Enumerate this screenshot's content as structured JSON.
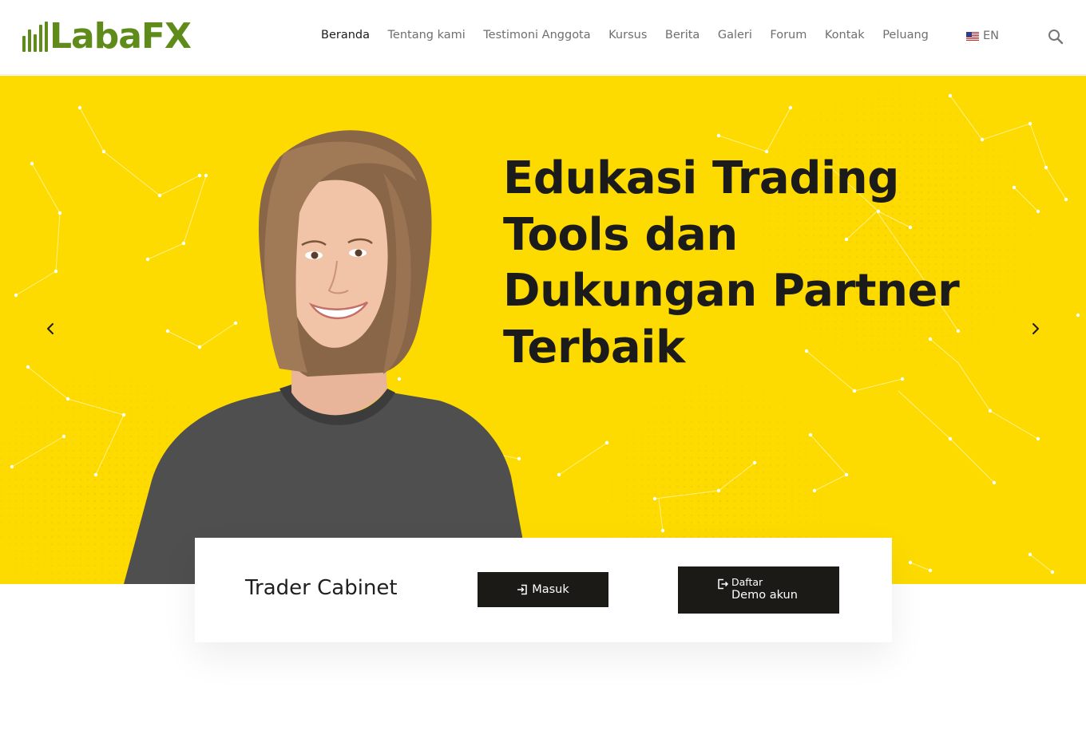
{
  "brand": {
    "logo_text": "LabaFX",
    "color": "#5f8b1a"
  },
  "nav": {
    "items": [
      {
        "label": "Beranda",
        "active": true
      },
      {
        "label": "Tentang kami",
        "active": false
      },
      {
        "label": "Testimoni Anggota",
        "active": false
      },
      {
        "label": "Kursus",
        "active": false
      },
      {
        "label": "Berita",
        "active": false
      },
      {
        "label": "Galeri",
        "active": false
      },
      {
        "label": "Forum",
        "active": false
      },
      {
        "label": "Kontak",
        "active": false
      },
      {
        "label": "Peluang",
        "active": false
      }
    ],
    "language": {
      "label": "EN",
      "icon": "us-flag-icon"
    },
    "search_icon": "search-icon"
  },
  "hero": {
    "headline_lines": [
      "Edukasi Trading",
      "Tools dan",
      "Dukungan Partner",
      "Terbaik"
    ],
    "background_color": "#fddb00",
    "prev_icon": "chevron-left-icon",
    "next_icon": "chevron-right-icon"
  },
  "cabinet": {
    "title": "Trader Cabinet",
    "login_button": {
      "label": "Masuk",
      "icon": "login-icon"
    },
    "demo_button": {
      "small_label": "Daftar",
      "label": "Demo akun",
      "icon": "logout-icon"
    },
    "button_color": "#1b1a16"
  }
}
